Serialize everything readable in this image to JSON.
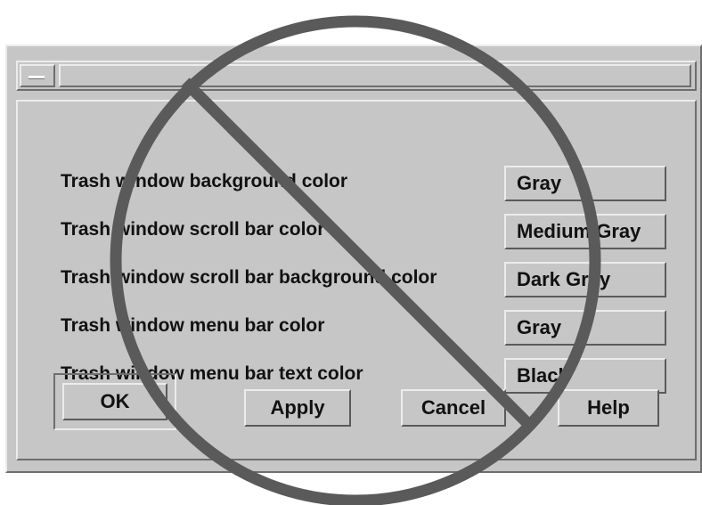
{
  "window": {
    "title": ""
  },
  "settings": [
    {
      "label": "Trash window background color",
      "value": "Gray"
    },
    {
      "label": "Trash window scroll bar color",
      "value": "Medium Gray"
    },
    {
      "label": "Trash window scroll bar background color",
      "value": "Dark Gray"
    },
    {
      "label": "Trash window menu bar color",
      "value": "Gray"
    },
    {
      "label": "Trash window menu bar text color",
      "value": "Black"
    }
  ],
  "buttons": {
    "ok": "OK",
    "apply": "Apply",
    "cancel": "Cancel",
    "help": "Help"
  },
  "overlay": {
    "icon": "prohibition-sign-icon",
    "color": "#5a5a5a"
  },
  "colors": {
    "panel": "#c6c6c6",
    "highlight": "#ececec",
    "shadow": "#6e6e6e"
  }
}
